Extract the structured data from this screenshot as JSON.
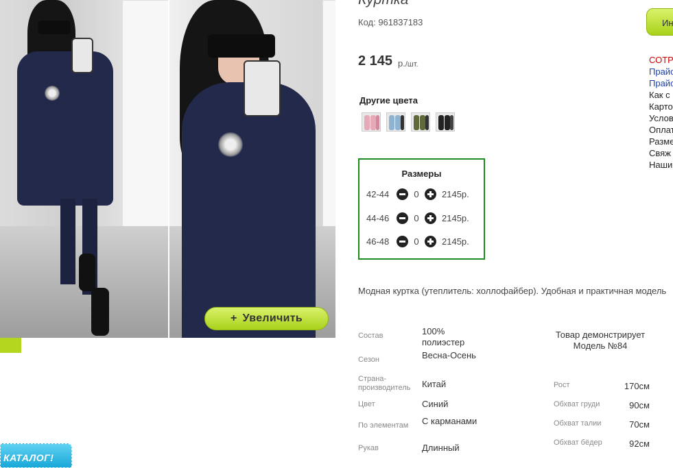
{
  "product": {
    "title": "Куртка",
    "code": "Код: 961837183",
    "price": "2 145",
    "price_unit": "р.",
    "price_per": "/шт."
  },
  "photo": {
    "zoom_button_label": "Увеличить",
    "zoom_button_icon": "+"
  },
  "catalog_badge": "КАТАЛОГ!",
  "other_colors": {
    "title": "Другие цвета",
    "swatches": [
      "pink-swatch",
      "blue-swatch",
      "olive-swatch",
      "black-swatch"
    ]
  },
  "sizes": {
    "title": "Размеры",
    "rows": [
      {
        "label": "42-44",
        "qty": "0",
        "price": "2145р."
      },
      {
        "label": "44-46",
        "qty": "0",
        "price": "2145р."
      },
      {
        "label": "46-48",
        "qty": "0",
        "price": "2145р."
      }
    ]
  },
  "description": "Модная куртка (утеплитель: холлофайбер). Удобная и практичная модель",
  "specs": [
    {
      "key": "Состав",
      "value": "100% полиэстер"
    },
    {
      "key": "Сезон",
      "value": "Весна-Осень"
    },
    {
      "key": "Страна-производитель",
      "value": "Китай"
    },
    {
      "key": "Цвет",
      "value": "Синий"
    },
    {
      "key": "По элементам",
      "value": "С карманами"
    },
    {
      "key": "Рукав",
      "value": "Длинный"
    }
  ],
  "model": {
    "title": "Товар демонстрирует Модель №84",
    "measurements": [
      {
        "key": "Рост",
        "value": "170см"
      },
      {
        "key": "Обхват груди",
        "value": "90см"
      },
      {
        "key": "Обхват талии",
        "value": "70см"
      },
      {
        "key": "Обхват бёдер",
        "value": "92см"
      }
    ]
  },
  "sidebar": {
    "cart_button": "Ин",
    "links": [
      "СОТР",
      "Прайс",
      "Прайс",
      "Как с",
      "Карто",
      "Услов",
      "Оплат",
      "Разме",
      "Свяж",
      "Наши"
    ]
  },
  "colors": {
    "accent_green": "#b3d61e",
    "sizes_border": "#1f8a1f",
    "coat": "#23294a",
    "catalog_blue": "#1aa7d8"
  }
}
